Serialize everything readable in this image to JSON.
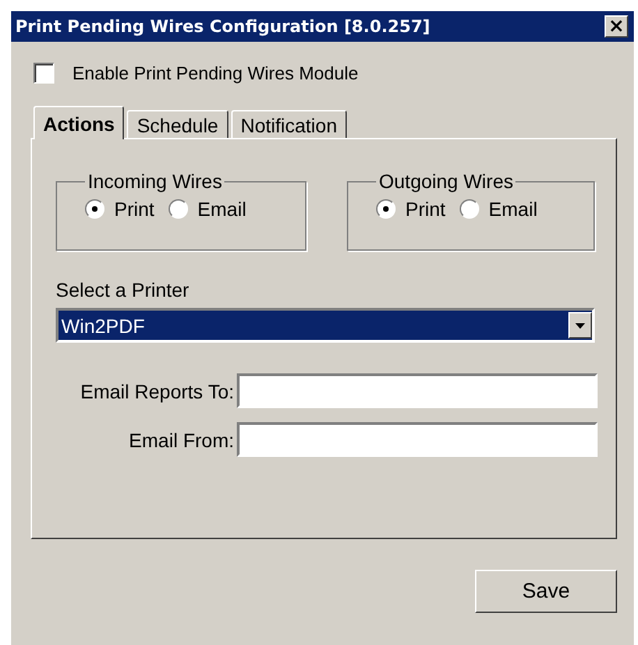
{
  "window": {
    "title": "Print Pending Wires Configuration [8.0.257]",
    "close": "×"
  },
  "enable": {
    "label": "Enable Print Pending Wires Module",
    "checked": false
  },
  "tabs": [
    {
      "label": "Actions",
      "selected": true
    },
    {
      "label": "Schedule",
      "selected": false
    },
    {
      "label": "Notification",
      "selected": false
    }
  ],
  "groups": [
    {
      "title": "Incoming Wires",
      "options": [
        {
          "label": "Print",
          "selected": true
        },
        {
          "label": "Email",
          "selected": false
        }
      ]
    },
    {
      "title": "Outgoing Wires",
      "options": [
        {
          "label": "Print",
          "selected": true
        },
        {
          "label": "Email",
          "selected": false
        }
      ]
    }
  ],
  "printer": {
    "label": "Select a Printer",
    "value": "Win2PDF"
  },
  "fields": [
    {
      "label": "Email Reports To:"
    },
    {
      "label": "Email From:"
    }
  ],
  "buttons": [
    "Save"
  ]
}
